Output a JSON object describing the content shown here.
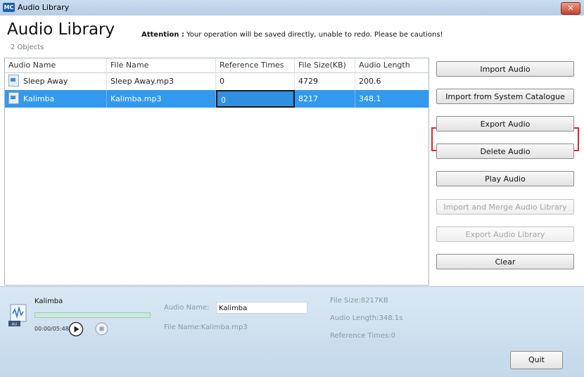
{
  "window": {
    "title": "Audio Library",
    "app_badge": "MC"
  },
  "header": {
    "title": "Audio Library",
    "attention_label": "Attention :",
    "attention_text": " Your operation will be saved directly, unable to redo. Please be cautions!",
    "count": "2 Objects"
  },
  "table": {
    "columns": [
      "Audio Name",
      "File Name",
      "Reference Times",
      "File Size(KB)",
      "Audio Length"
    ],
    "rows": [
      {
        "audio_name": "Sleep Away",
        "file_name": "Sleep Away.mp3",
        "reference_times": "0",
        "file_size": "4729",
        "audio_length": "200.6",
        "selected": false
      },
      {
        "audio_name": "Kalimba",
        "file_name": "Kalimba.mp3",
        "reference_times": "0",
        "file_size": "8217",
        "audio_length": "348.1",
        "selected": true
      }
    ]
  },
  "actions": {
    "import_audio": "Import Audio",
    "import_system": "Import from System Catalogue",
    "export_audio": "Export Audio",
    "delete_audio": "Delete Audio",
    "play_audio": "Play Audio",
    "import_merge": "Import and Merge Audio Library",
    "export_library": "Export Audio Library",
    "clear": "Clear"
  },
  "player": {
    "track": "Kalimba",
    "time": "00:00/05:48",
    "badge": "AU",
    "audio_name_label": "Audio Name:",
    "audio_name_value": "Kalimba",
    "file_name": "File Name:Kalimba.mp3",
    "file_size": "File Size:8217KB",
    "audio_length": "Audio Length:348.1s",
    "reference_times": "Reference Times:0",
    "progress": 0
  },
  "footer": {
    "quit": "Quit"
  },
  "colors": {
    "selection": "#3399ee",
    "highlight_box": "#d82a2a",
    "panel": "#cfe0ef"
  }
}
